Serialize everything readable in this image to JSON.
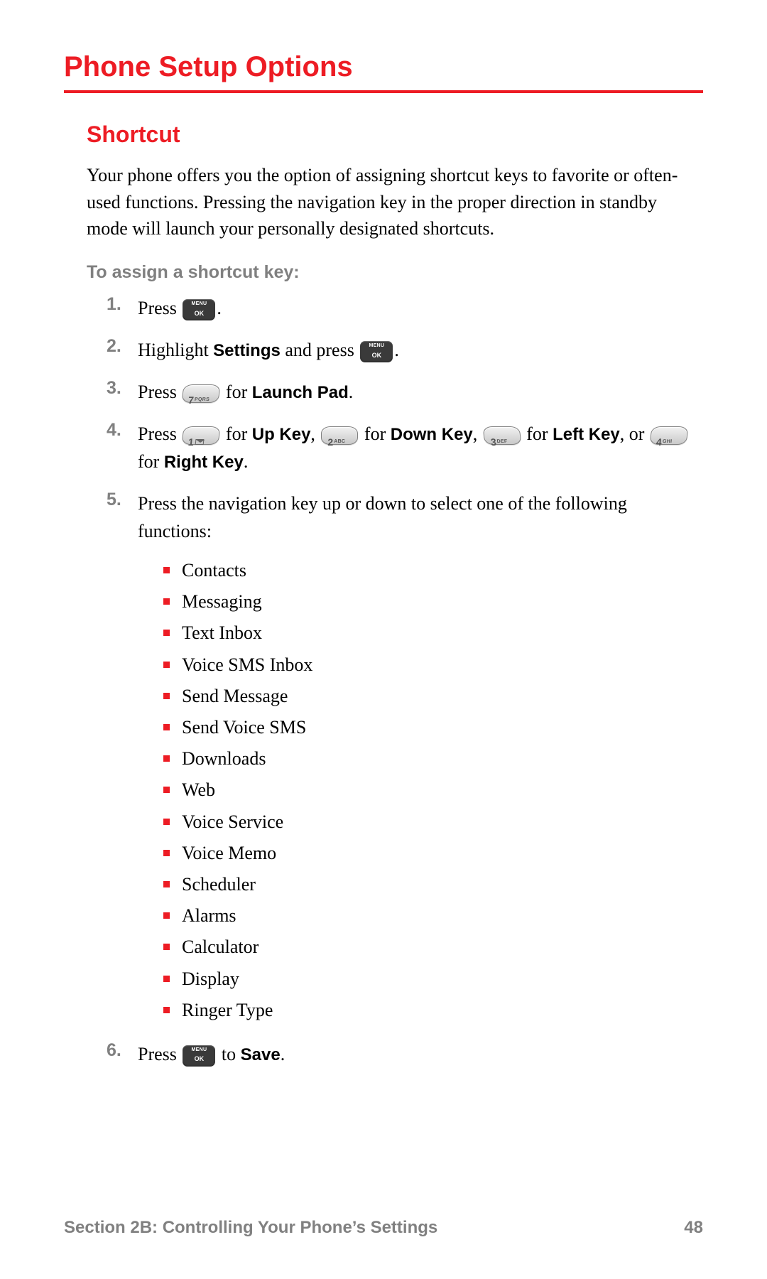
{
  "title": "Phone Setup Options",
  "section": "Shortcut",
  "intro": "Your phone offers you the option of assigning shortcut keys to favorite or often-used functions. Pressing the navigation key in the proper direction in standby mode will launch your personally designated shortcuts.",
  "task_label": "To assign a shortcut key:",
  "steps": {
    "s1": {
      "num": "1.",
      "press": "Press ",
      "period": "."
    },
    "s2": {
      "num": "2.",
      "a": "Highlight ",
      "settings": "Settings",
      "b": " and press ",
      "period": "."
    },
    "s3": {
      "num": "3.",
      "press": "Press ",
      "for": " for ",
      "launch": "Launch Pad",
      "period": "."
    },
    "s4": {
      "num": "4.",
      "press": "Press ",
      "for1": " for ",
      "up": "Up Key",
      "c1": ", ",
      "for2": " for ",
      "down": "Down Key",
      "c2": ", ",
      "for3": " for ",
      "left": "Left Key",
      "c3": ", or ",
      "for4": " for ",
      "right": "Right Key",
      "period": "."
    },
    "s5": {
      "num": "5.",
      "text": "Press the navigation key up or down to select one of the following functions:"
    },
    "s6": {
      "num": "6.",
      "press": "Press ",
      "to": " to ",
      "save": "Save",
      "period": "."
    }
  },
  "keys": {
    "k1": {
      "digit": "1"
    },
    "k2": {
      "digit": "2",
      "sub": "ABC"
    },
    "k3": {
      "digit": "3",
      "sub": "DEF"
    },
    "k4": {
      "digit": "4",
      "sub": "GHI"
    },
    "k7": {
      "digit": "7",
      "sub": "PQRS"
    }
  },
  "functions": [
    "Contacts",
    "Messaging",
    "Text Inbox",
    "Voice SMS Inbox",
    "Send Message",
    "Send Voice SMS",
    "Downloads",
    "Web",
    "Voice Service",
    "Voice Memo",
    "Scheduler",
    "Alarms",
    "Calculator",
    "Display",
    "Ringer Type"
  ],
  "footer": {
    "section": "Section 2B: Controlling Your Phone’s Settings",
    "page": "48"
  }
}
